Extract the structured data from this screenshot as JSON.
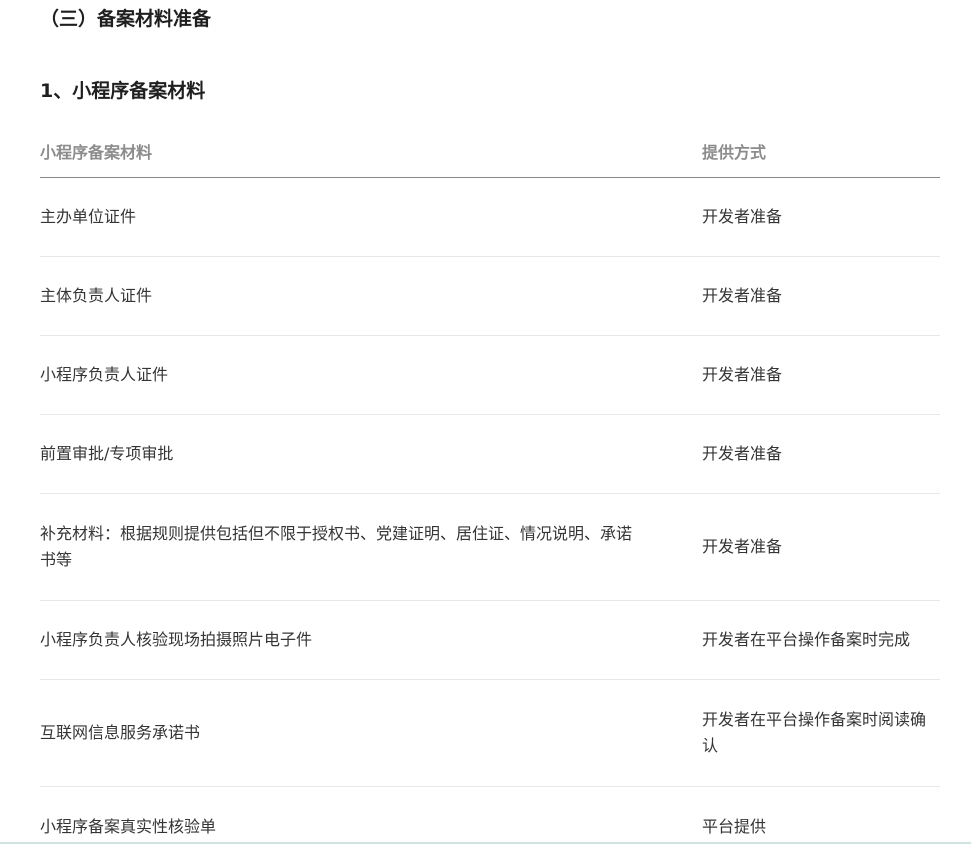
{
  "section": {
    "title": "（三）备案材料准备"
  },
  "subsection": {
    "title": "1、小程序备案材料"
  },
  "table": {
    "headers": {
      "material": "小程序备案材料",
      "method": "提供方式"
    },
    "rows": [
      {
        "material": "主办单位证件",
        "method": "开发者准备"
      },
      {
        "material": "主体负责人证件",
        "method": "开发者准备"
      },
      {
        "material": "小程序负责人证件",
        "method": "开发者准备"
      },
      {
        "material": "前置审批/专项审批",
        "method": "开发者准备"
      },
      {
        "material": "补充材料：根据规则提供包括但不限于授权书、党建证明、居住证、情况说明、承诺书等",
        "method": "开发者准备"
      },
      {
        "material": "小程序负责人核验现场拍摄照片电子件",
        "method": "开发者在平台操作备案时完成"
      },
      {
        "material": "互联网信息服务承诺书",
        "method": "开发者在平台操作备案时阅读确认"
      },
      {
        "material": "小程序备案真实性核验单",
        "method": "平台提供"
      }
    ]
  }
}
